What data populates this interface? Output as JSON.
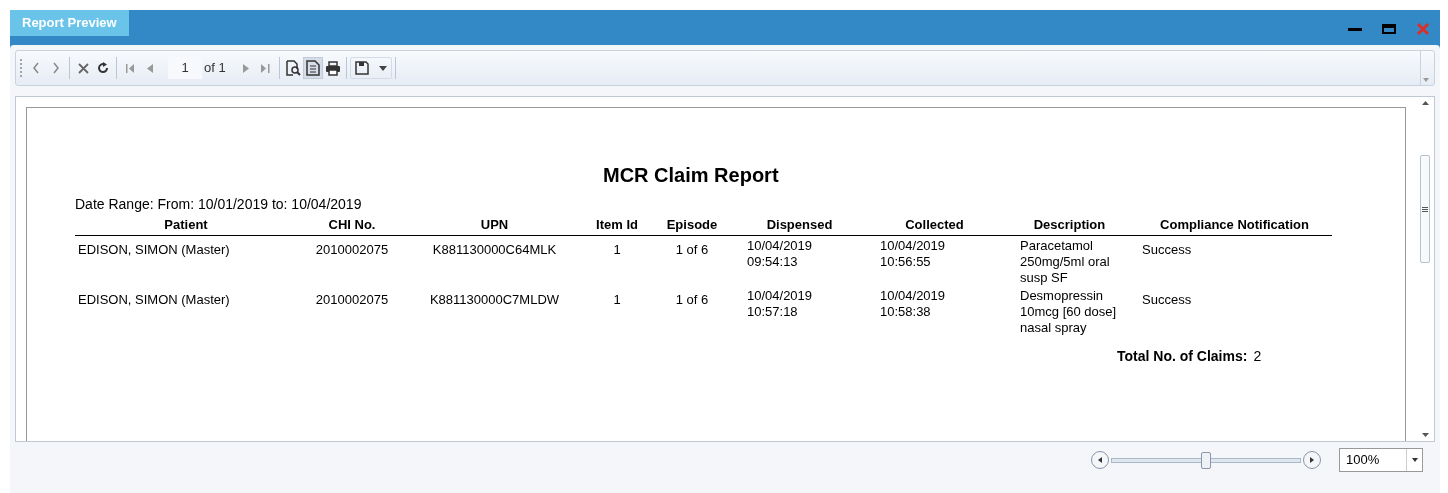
{
  "window": {
    "title": "Report Preview"
  },
  "toolbar": {
    "page_number": "1",
    "page_count": "of 1",
    "page_view_selected": true
  },
  "report": {
    "title": "MCR Claim Report",
    "date_range": "Date Range: From: 10/01/2019 to: 10/04/2019",
    "columns": [
      "Patient",
      "CHI No.",
      "UPN",
      "Item Id",
      "Episode",
      "Dispensed",
      "Collected",
      "Description",
      "Compliance Notification"
    ],
    "rows": [
      [
        "EDISON, SIMON (Master)",
        "2010002075",
        "K881130000C64MLK",
        "1",
        "1 of 6",
        "10/04/2019 09:54:13",
        "10/04/2019 10:56:55",
        "Paracetamol 250mg/5ml oral susp SF",
        "Success"
      ],
      [
        "EDISON, SIMON (Master)",
        "2010002075",
        "K881130000C7MLDW",
        "1",
        "1 of 6",
        "10/04/2019 10:57:18",
        "10/04/2019 10:58:38",
        "Desmopressin 10mcg [60 dose] nasal spray",
        "Success"
      ]
    ],
    "total_label": "Total No. of Claims:",
    "total_value": "2"
  },
  "zoom": {
    "level": 0.5,
    "value": "100%"
  }
}
